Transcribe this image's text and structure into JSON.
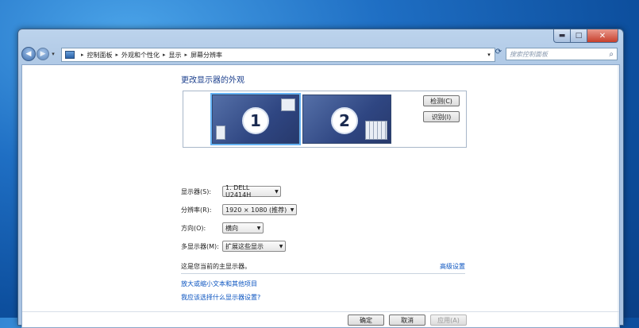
{
  "window": {
    "caption": {
      "min": "▬",
      "max": "□",
      "close": "✕"
    }
  },
  "navigation": {
    "breadcrumbs": [
      "控制面板",
      "外观和个性化",
      "显示",
      "屏幕分辨率"
    ],
    "search_placeholder": "搜索控制面板"
  },
  "page": {
    "heading": "更改显示器的外观",
    "monitors": [
      {
        "number": "1",
        "selected": true
      },
      {
        "number": "2",
        "selected": false
      }
    ],
    "detect_label": "检测(C)",
    "identify_label": "识别(I)",
    "settings": {
      "display_label": "显示器(S):",
      "display_value": "1. DELL U2414H",
      "resolution_label": "分辨率(R):",
      "resolution_value": "1920 × 1080 (推荐)",
      "orientation_label": "方向(O):",
      "orientation_value": "横向",
      "multi_label": "多显示器(M):",
      "multi_value": "扩展这些显示"
    },
    "info_text": "这是您当前的主显示器。",
    "advanced_link": "高级设置",
    "link_enlarge": "放大或缩小文本和其他项目",
    "link_help": "我应该选择什么显示器设置?"
  },
  "footer": {
    "ok": "确定",
    "cancel": "取消",
    "apply": "应用(A)"
  },
  "colors": {
    "link": "#0c55c0",
    "heading": "#1a3e8c"
  }
}
